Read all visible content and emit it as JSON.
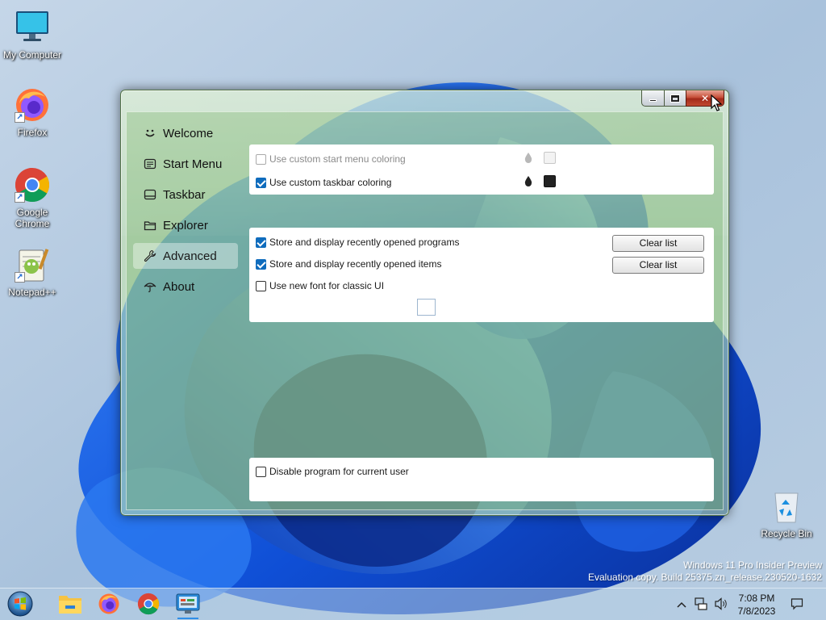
{
  "desktop": {
    "icons": [
      {
        "label": "My Computer"
      },
      {
        "label": "Firefox"
      },
      {
        "label": "Google Chrome"
      },
      {
        "label": "Notepad++"
      },
      {
        "label": "Recycle Bin"
      }
    ],
    "watermark": {
      "line1": "Windows 11 Pro Insider Preview",
      "line2": "Evaluation copy. Build 25375.zn_release.230520-1632"
    }
  },
  "window": {
    "nav": [
      {
        "label": "Welcome",
        "icon": "smile-icon"
      },
      {
        "label": "Start Menu",
        "icon": "start-menu-icon"
      },
      {
        "label": "Taskbar",
        "icon": "taskbar-icon"
      },
      {
        "label": "Explorer",
        "icon": "folder-icon"
      },
      {
        "label": "Advanced",
        "icon": "wrench-icon",
        "active": true
      },
      {
        "label": "About",
        "icon": "umbrella-icon"
      }
    ],
    "coloring": {
      "start_menu": {
        "label": "Use custom start menu coloring",
        "checked": false,
        "enabled": false,
        "swatch": "#f3f3f3"
      },
      "taskbar": {
        "label": "Use custom taskbar coloring",
        "checked": true,
        "enabled": true,
        "swatch": "#222222"
      }
    },
    "history": {
      "programs": {
        "label": "Store and display recently opened programs",
        "checked": true,
        "button": "Clear list"
      },
      "items": {
        "label": "Store and display recently opened items",
        "checked": true,
        "button": "Clear list"
      },
      "font": {
        "label": "Use new font for classic UI",
        "checked": false
      }
    },
    "disable": {
      "label": "Disable program for current user",
      "checked": false
    }
  },
  "taskbar": {
    "apps": [
      "start-orb-icon",
      "file-explorer-icon",
      "firefox-icon",
      "chrome-icon",
      "control-panel-icon"
    ],
    "clock": {
      "time": "7:08 PM",
      "date": "7/8/2023"
    }
  },
  "colors": {
    "accent": "#0f6cbd",
    "window_glass": "#c6e8aa",
    "close_button": "#c7503a"
  }
}
